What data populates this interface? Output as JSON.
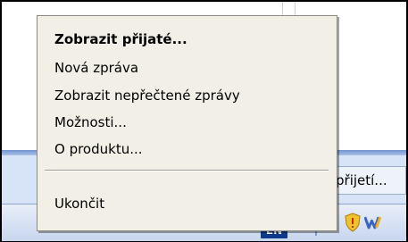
{
  "menu": {
    "items": [
      {
        "label": "Zobrazit přijaté...",
        "bold": true
      },
      {
        "label": "Nová zpráva",
        "bold": false
      },
      {
        "label": "Zobrazit nepřečtené zprávy",
        "bold": false
      },
      {
        "label": "Možnosti...",
        "bold": false
      },
      {
        "label": "O produktu...",
        "bold": false
      },
      {
        "label": "Ukončit",
        "bold": false
      }
    ]
  },
  "background": {
    "label_text": "přijetí..."
  },
  "taskbar": {
    "language": "EN",
    "tray_icons": [
      "network-icon",
      "shield-icon",
      "app-w-icon"
    ]
  },
  "colors": {
    "menu_bg": "#f2f0e6",
    "taskbar_accent": "#0f3a8c",
    "shield_yellow": "#f2c12e"
  }
}
